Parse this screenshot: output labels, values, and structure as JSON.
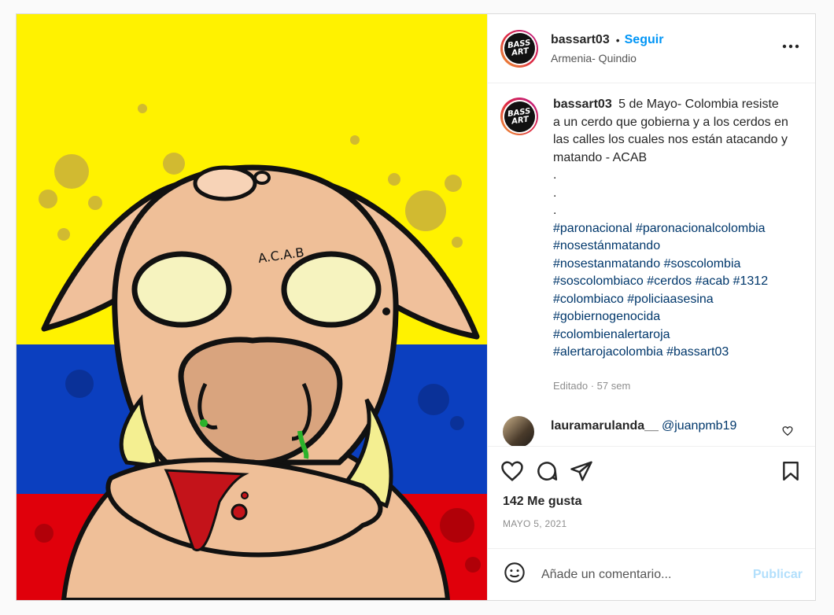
{
  "post": {
    "author": "bassart03",
    "avatar_text": "BASS ART",
    "follow_label": "Seguir",
    "separator": "•",
    "location": "Armenia- Quindio",
    "more_icon": "more-horizontal-icon"
  },
  "image": {
    "engraved_text": "A.C.A.B",
    "flag_colors": [
      "#fff200",
      "#0b3fbf",
      "#e0000b"
    ]
  },
  "caption": {
    "username": "bassart03",
    "text": "5 de Mayo- Colombia resiste a un cerdo que gobierna y a los cerdos en las calles los cuales nos están atacando y matando - ACAB",
    "dots": [
      ".",
      ".",
      "."
    ],
    "hashtags": [
      "#paronacional",
      "#paronacionalcolombia",
      "#nosestánmatando",
      "#nosestanmatando",
      "#soscolombia",
      "#soscolombiaco",
      "#cerdos",
      "#acab",
      "#1312",
      "#colombiaco",
      "#policiaasesina",
      "#gobiernogenocida",
      "#colombienalertaroja",
      "#alertarojacolombia",
      "#bassart03"
    ],
    "meta": "Editado · 57 sem"
  },
  "comment": {
    "username": "lauramarulanda__",
    "mention": "@juanpmb19"
  },
  "actions": {
    "likes": "142 Me gusta",
    "date": "MAYO 5, 2021"
  },
  "composer": {
    "placeholder": "Añade un comentario...",
    "publish_label": "Publicar"
  }
}
